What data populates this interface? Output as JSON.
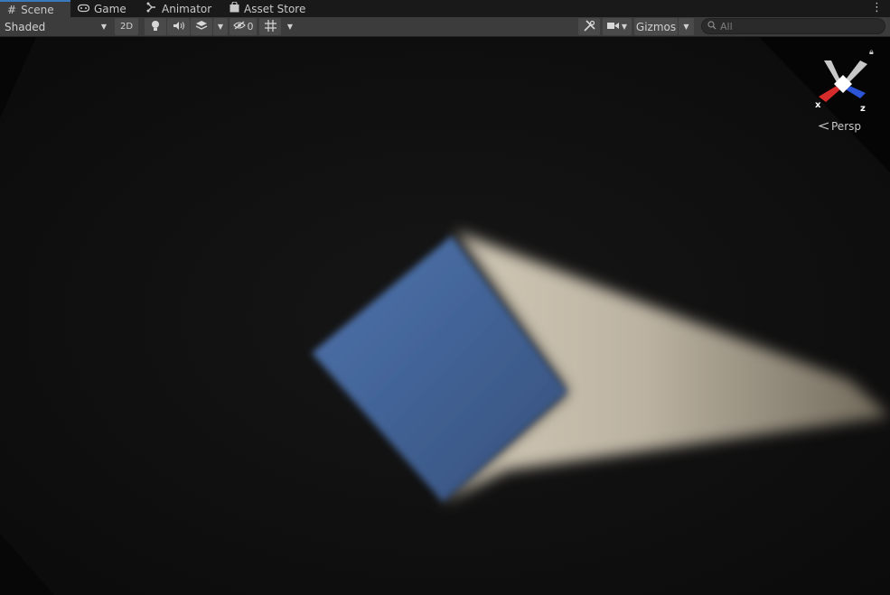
{
  "tabs": [
    {
      "label": "Scene",
      "icon": "grid-icon",
      "active": true
    },
    {
      "label": "Game",
      "icon": "gamepad-icon",
      "active": false
    },
    {
      "label": "Animator",
      "icon": "animator-icon",
      "active": false
    },
    {
      "label": "Asset Store",
      "icon": "store-bag-icon",
      "active": false
    }
  ],
  "toolbar": {
    "draw_mode": "Shaded",
    "mode_2d": "2D",
    "hidden_count": "0",
    "gizmos_label": "Gizmos",
    "search_placeholder": "All"
  },
  "gizmo": {
    "x_label": "x",
    "z_label": "z",
    "projection": "Persp",
    "x_color": "#d62b2b",
    "z_color": "#2b55d6"
  },
  "colors": {
    "accent": "#3a79bb",
    "sky": "#4a6ea8",
    "sunlit_wall": "#cfc6b4"
  }
}
